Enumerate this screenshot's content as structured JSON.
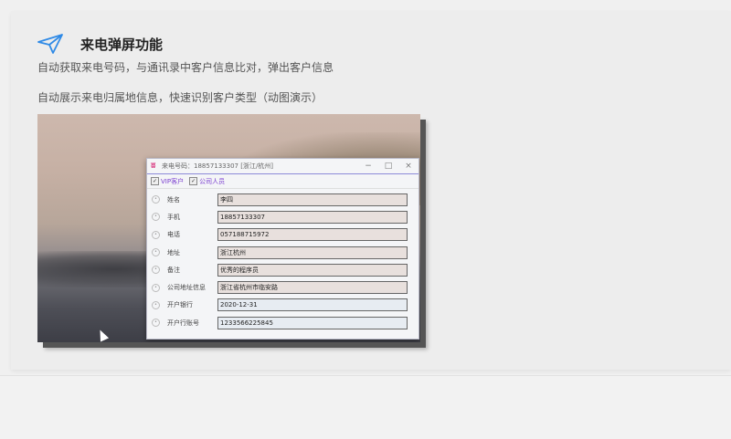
{
  "section": {
    "title": "来电弹屏功能",
    "description_1": "自动获取来电号码，与通讯录中客户信息比对，弹出客户信息",
    "description_2": "自动展示来电归属地信息，快速识别客户类型（动图演示）",
    "icon": "paper-plane-icon",
    "accent_color": "#2f8ae6"
  },
  "popup": {
    "title": "来电号码：18857133307 [浙江/杭州]",
    "minimize": "−",
    "maximize": "□",
    "close": "×",
    "checkboxes": [
      {
        "label": "VIP客户",
        "checked": true
      },
      {
        "label": "公司人员",
        "checked": true
      }
    ],
    "fields": [
      {
        "label": "姓名",
        "value": "李四"
      },
      {
        "label": "手机",
        "value": "18857133307"
      },
      {
        "label": "电话",
        "value": "057188715972"
      },
      {
        "label": "地址",
        "value": "浙江杭州"
      },
      {
        "label": "备注",
        "value": "优秀的程序员"
      },
      {
        "label": "公司地址信息",
        "value": "浙江省杭州市临安路"
      },
      {
        "label": "开户银行",
        "value": "2020-12-31"
      },
      {
        "label": "开户行账号",
        "value": "1233566225845"
      }
    ]
  }
}
